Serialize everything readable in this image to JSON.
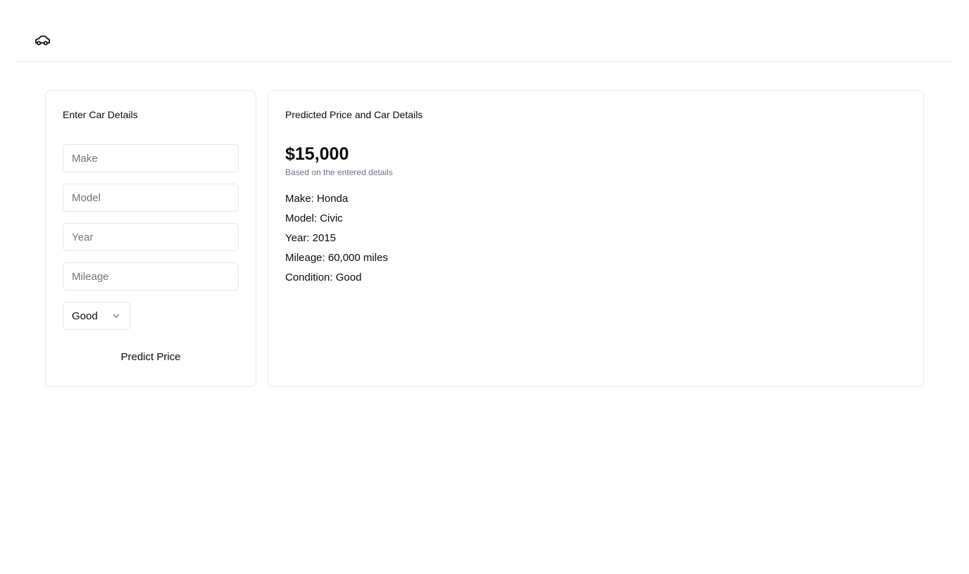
{
  "header": {
    "logo_icon": "car-icon"
  },
  "form": {
    "title": "Enter Car Details",
    "make_placeholder": "Make",
    "model_placeholder": "Model",
    "year_placeholder": "Year",
    "mileage_placeholder": "Mileage",
    "condition_value": "Good",
    "predict_label": "Predict Price"
  },
  "result": {
    "title": "Predicted Price and Car Details",
    "price": "$15,000",
    "subtitle": "Based on the entered details",
    "details": [
      "Make: Honda",
      "Model: Civic",
      "Year: 2015",
      "Mileage: 60,000 miles",
      "Condition: Good"
    ]
  },
  "colors": {
    "border": "#e5e7eb",
    "muted": "#6b7280",
    "text": "#0a0a0a"
  }
}
